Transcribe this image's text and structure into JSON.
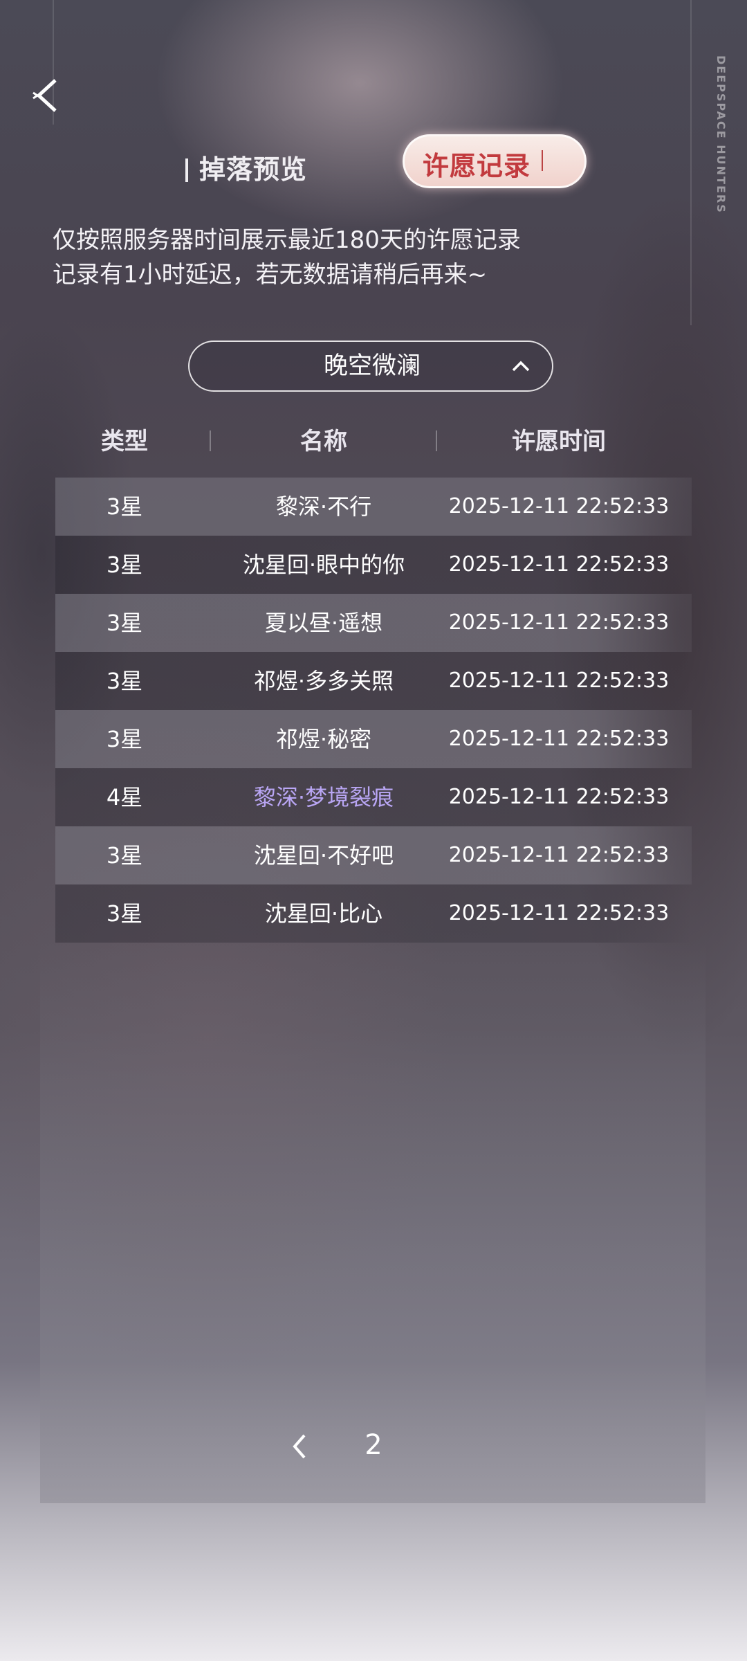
{
  "header": {
    "back_icon": "back-chevron-icon",
    "brand_text": "DEEPSPACE HUNTERS"
  },
  "tabs": [
    {
      "label": "掉落预览",
      "active": false
    },
    {
      "label": "许愿记录",
      "active": true
    }
  ],
  "notice": {
    "line1": "仅按照服务器时间展示最近180天的许愿记录",
    "line2": "记录有1小时延迟，若无数据请稍后再来~"
  },
  "selector": {
    "value": "晚空微澜",
    "icon": "chevron-up-icon"
  },
  "table": {
    "headers": [
      "类型",
      "名称",
      "许愿时间"
    ],
    "rows": [
      {
        "type": "3星",
        "name": "黎深·不行",
        "time": "2025-12-11 22:52:33"
      },
      {
        "type": "3星",
        "name": "沈星回·眼中的你",
        "time": "2025-12-11 22:52:33"
      },
      {
        "type": "3星",
        "name": "夏以昼·遥想",
        "time": "2025-12-11 22:52:33"
      },
      {
        "type": "3星",
        "name": "祁煜·多多关照",
        "time": "2025-12-11 22:52:33"
      },
      {
        "type": "3星",
        "name": "祁煜·秘密",
        "time": "2025-12-11 22:52:33"
      },
      {
        "type": "4星",
        "name": "黎深·梦境裂痕",
        "time": "2025-12-11 22:52:33"
      },
      {
        "type": "3星",
        "name": "沈星回·不好吧",
        "time": "2025-12-11 22:52:33"
      },
      {
        "type": "3星",
        "name": "沈星回·比心",
        "time": "2025-12-11 22:52:33"
      }
    ]
  },
  "pager": {
    "prev_icon": "chevron-left-icon",
    "page": "2"
  },
  "colors": {
    "active_tab_text": "#c23a3e",
    "four_star_name": "#b9a6f4"
  }
}
